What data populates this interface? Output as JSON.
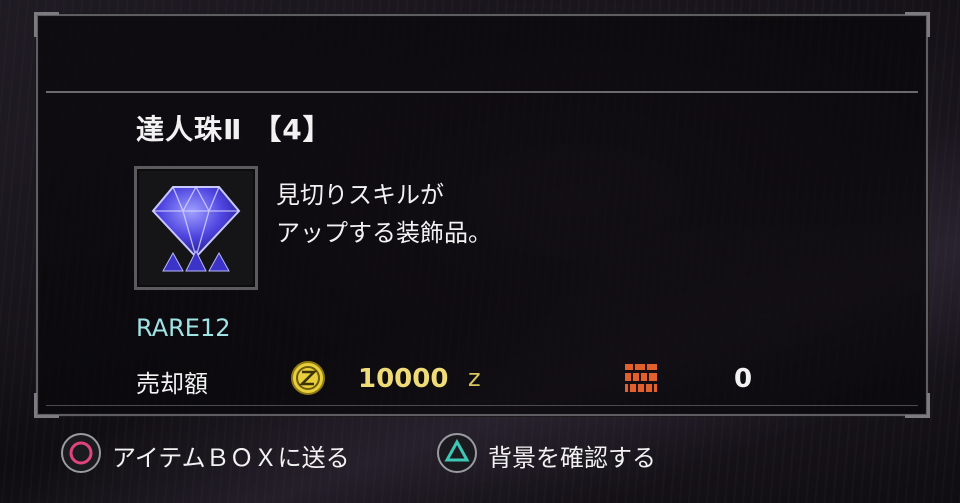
{
  "item": {
    "name": "達人珠Ⅱ 【4】",
    "description_line1": "見切りスキルが",
    "description_line2": "アップする装飾品。",
    "icon": "gem-icon",
    "gem_color": "#4f45e0",
    "rarity": "RARE12"
  },
  "sell": {
    "label": "売却額",
    "zenny_icon": "zenny-coin-icon",
    "zenny_amount": "10000",
    "zenny_unit": "z",
    "points_icon": "research-points-icon",
    "points_value": "0"
  },
  "footer": {
    "send_label": "アイテムＢＯＸに送る",
    "send_glyph": "circle-button-icon",
    "background_label": "背景を確認する",
    "background_glyph": "triangle-button-icon"
  }
}
